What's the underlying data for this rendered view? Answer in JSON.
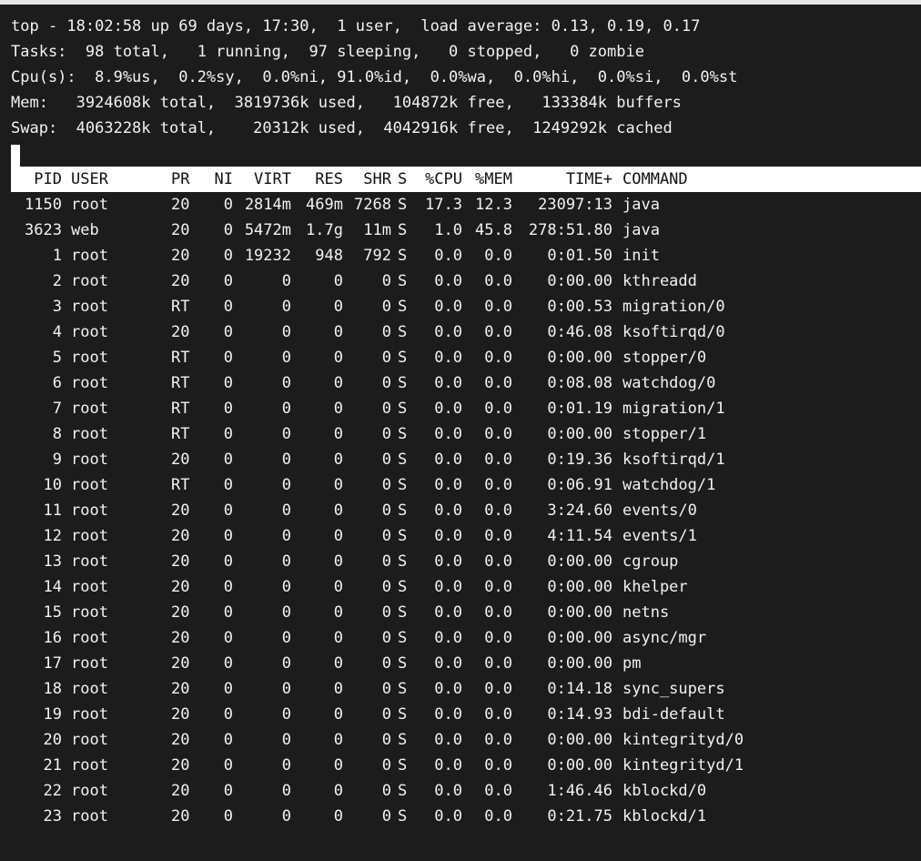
{
  "summary": {
    "line1": "top - 18:02:58 up 69 days, 17:30,  1 user,  load average: 0.13, 0.19, 0.17",
    "line2": "Tasks:  98 total,   1 running,  97 sleeping,   0 stopped,   0 zombie",
    "line3": "Cpu(s):  8.9%us,  0.2%sy,  0.0%ni, 91.0%id,  0.0%wa,  0.0%hi,  0.0%si,  0.0%st",
    "line4": "Mem:   3924608k total,  3819736k used,   104872k free,   133384k buffers",
    "line5": "Swap:  4063228k total,    20312k used,  4042916k free,  1249292k cached"
  },
  "columns": {
    "pid": "PID",
    "user": "USER",
    "pr": "PR",
    "ni": "NI",
    "virt": "VIRT",
    "res": "RES",
    "shr": "SHR",
    "s": "S",
    "cpu": "%CPU",
    "mem": "%MEM",
    "time": "TIME+",
    "command": "COMMAND"
  },
  "processes": [
    {
      "pid": "1150",
      "user": "root",
      "pr": "20",
      "ni": "0",
      "virt": "2814m",
      "res": "469m",
      "shr": "7268",
      "s": "S",
      "cpu": "17.3",
      "mem": "12.3",
      "time": "23097:13",
      "command": "java"
    },
    {
      "pid": "3623",
      "user": "web",
      "pr": "20",
      "ni": "0",
      "virt": "5472m",
      "res": "1.7g",
      "shr": "11m",
      "s": "S",
      "cpu": "1.0",
      "mem": "45.8",
      "time": "278:51.80",
      "command": "java"
    },
    {
      "pid": "1",
      "user": "root",
      "pr": "20",
      "ni": "0",
      "virt": "19232",
      "res": "948",
      "shr": "792",
      "s": "S",
      "cpu": "0.0",
      "mem": "0.0",
      "time": "0:01.50",
      "command": "init"
    },
    {
      "pid": "2",
      "user": "root",
      "pr": "20",
      "ni": "0",
      "virt": "0",
      "res": "0",
      "shr": "0",
      "s": "S",
      "cpu": "0.0",
      "mem": "0.0",
      "time": "0:00.00",
      "command": "kthreadd"
    },
    {
      "pid": "3",
      "user": "root",
      "pr": "RT",
      "ni": "0",
      "virt": "0",
      "res": "0",
      "shr": "0",
      "s": "S",
      "cpu": "0.0",
      "mem": "0.0",
      "time": "0:00.53",
      "command": "migration/0"
    },
    {
      "pid": "4",
      "user": "root",
      "pr": "20",
      "ni": "0",
      "virt": "0",
      "res": "0",
      "shr": "0",
      "s": "S",
      "cpu": "0.0",
      "mem": "0.0",
      "time": "0:46.08",
      "command": "ksoftirqd/0"
    },
    {
      "pid": "5",
      "user": "root",
      "pr": "RT",
      "ni": "0",
      "virt": "0",
      "res": "0",
      "shr": "0",
      "s": "S",
      "cpu": "0.0",
      "mem": "0.0",
      "time": "0:00.00",
      "command": "stopper/0"
    },
    {
      "pid": "6",
      "user": "root",
      "pr": "RT",
      "ni": "0",
      "virt": "0",
      "res": "0",
      "shr": "0",
      "s": "S",
      "cpu": "0.0",
      "mem": "0.0",
      "time": "0:08.08",
      "command": "watchdog/0"
    },
    {
      "pid": "7",
      "user": "root",
      "pr": "RT",
      "ni": "0",
      "virt": "0",
      "res": "0",
      "shr": "0",
      "s": "S",
      "cpu": "0.0",
      "mem": "0.0",
      "time": "0:01.19",
      "command": "migration/1"
    },
    {
      "pid": "8",
      "user": "root",
      "pr": "RT",
      "ni": "0",
      "virt": "0",
      "res": "0",
      "shr": "0",
      "s": "S",
      "cpu": "0.0",
      "mem": "0.0",
      "time": "0:00.00",
      "command": "stopper/1"
    },
    {
      "pid": "9",
      "user": "root",
      "pr": "20",
      "ni": "0",
      "virt": "0",
      "res": "0",
      "shr": "0",
      "s": "S",
      "cpu": "0.0",
      "mem": "0.0",
      "time": "0:19.36",
      "command": "ksoftirqd/1"
    },
    {
      "pid": "10",
      "user": "root",
      "pr": "RT",
      "ni": "0",
      "virt": "0",
      "res": "0",
      "shr": "0",
      "s": "S",
      "cpu": "0.0",
      "mem": "0.0",
      "time": "0:06.91",
      "command": "watchdog/1"
    },
    {
      "pid": "11",
      "user": "root",
      "pr": "20",
      "ni": "0",
      "virt": "0",
      "res": "0",
      "shr": "0",
      "s": "S",
      "cpu": "0.0",
      "mem": "0.0",
      "time": "3:24.60",
      "command": "events/0"
    },
    {
      "pid": "12",
      "user": "root",
      "pr": "20",
      "ni": "0",
      "virt": "0",
      "res": "0",
      "shr": "0",
      "s": "S",
      "cpu": "0.0",
      "mem": "0.0",
      "time": "4:11.54",
      "command": "events/1"
    },
    {
      "pid": "13",
      "user": "root",
      "pr": "20",
      "ni": "0",
      "virt": "0",
      "res": "0",
      "shr": "0",
      "s": "S",
      "cpu": "0.0",
      "mem": "0.0",
      "time": "0:00.00",
      "command": "cgroup"
    },
    {
      "pid": "14",
      "user": "root",
      "pr": "20",
      "ni": "0",
      "virt": "0",
      "res": "0",
      "shr": "0",
      "s": "S",
      "cpu": "0.0",
      "mem": "0.0",
      "time": "0:00.00",
      "command": "khelper"
    },
    {
      "pid": "15",
      "user": "root",
      "pr": "20",
      "ni": "0",
      "virt": "0",
      "res": "0",
      "shr": "0",
      "s": "S",
      "cpu": "0.0",
      "mem": "0.0",
      "time": "0:00.00",
      "command": "netns"
    },
    {
      "pid": "16",
      "user": "root",
      "pr": "20",
      "ni": "0",
      "virt": "0",
      "res": "0",
      "shr": "0",
      "s": "S",
      "cpu": "0.0",
      "mem": "0.0",
      "time": "0:00.00",
      "command": "async/mgr"
    },
    {
      "pid": "17",
      "user": "root",
      "pr": "20",
      "ni": "0",
      "virt": "0",
      "res": "0",
      "shr": "0",
      "s": "S",
      "cpu": "0.0",
      "mem": "0.0",
      "time": "0:00.00",
      "command": "pm"
    },
    {
      "pid": "18",
      "user": "root",
      "pr": "20",
      "ni": "0",
      "virt": "0",
      "res": "0",
      "shr": "0",
      "s": "S",
      "cpu": "0.0",
      "mem": "0.0",
      "time": "0:14.18",
      "command": "sync_supers"
    },
    {
      "pid": "19",
      "user": "root",
      "pr": "20",
      "ni": "0",
      "virt": "0",
      "res": "0",
      "shr": "0",
      "s": "S",
      "cpu": "0.0",
      "mem": "0.0",
      "time": "0:14.93",
      "command": "bdi-default"
    },
    {
      "pid": "20",
      "user": "root",
      "pr": "20",
      "ni": "0",
      "virt": "0",
      "res": "0",
      "shr": "0",
      "s": "S",
      "cpu": "0.0",
      "mem": "0.0",
      "time": "0:00.00",
      "command": "kintegrityd/0"
    },
    {
      "pid": "21",
      "user": "root",
      "pr": "20",
      "ni": "0",
      "virt": "0",
      "res": "0",
      "shr": "0",
      "s": "S",
      "cpu": "0.0",
      "mem": "0.0",
      "time": "0:00.00",
      "command": "kintegrityd/1"
    },
    {
      "pid": "22",
      "user": "root",
      "pr": "20",
      "ni": "0",
      "virt": "0",
      "res": "0",
      "shr": "0",
      "s": "S",
      "cpu": "0.0",
      "mem": "0.0",
      "time": "1:46.46",
      "command": "kblockd/0"
    },
    {
      "pid": "23",
      "user": "root",
      "pr": "20",
      "ni": "0",
      "virt": "0",
      "res": "0",
      "shr": "0",
      "s": "S",
      "cpu": "0.0",
      "mem": "0.0",
      "time": "0:21.75",
      "command": "kblockd/1"
    }
  ]
}
